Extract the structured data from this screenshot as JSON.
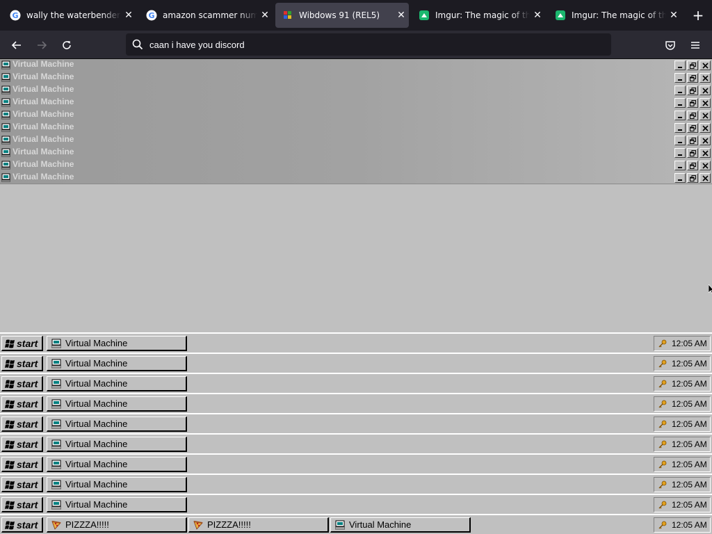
{
  "browser": {
    "tabs": [
      {
        "title": "wally the waterbender - Go",
        "favicon": "google-icon",
        "active": false
      },
      {
        "title": "amazon scammer numbers",
        "favicon": "google-icon",
        "active": false
      },
      {
        "title": "Wibdows 91 (REL5)",
        "favicon": "windows-flag-icon",
        "active": true
      },
      {
        "title": "Imgur: The magic of the Int",
        "favicon": "imgur-icon",
        "active": false
      },
      {
        "title": "Imgur: The magic of the Int",
        "favicon": "imgur-icon",
        "active": false
      }
    ],
    "new_tab": "+",
    "url_value": "caan i have you discord",
    "icons": [
      "back-icon",
      "forward-icon",
      "reload-icon",
      "search-icon",
      "pocket-icon",
      "menu-icon",
      "close-icon"
    ]
  },
  "vm_windows": [
    {
      "title": "Virtual Machine"
    },
    {
      "title": "Virtual Machine"
    },
    {
      "title": "Virtual Machine"
    },
    {
      "title": "Virtual Machine"
    },
    {
      "title": "Virtual Machine"
    },
    {
      "title": "Virtual Machine"
    },
    {
      "title": "Virtual Machine"
    },
    {
      "title": "Virtual Machine"
    },
    {
      "title": "Virtual Machine"
    },
    {
      "title": "Virtual Machine"
    }
  ],
  "taskbars": [
    {
      "start": "start",
      "clock": "12:05 AM",
      "tasks": [
        {
          "label": "Virtual Machine",
          "icon": "computer-icon"
        }
      ]
    },
    {
      "start": "start",
      "clock": "12:05 AM",
      "tasks": [
        {
          "label": "Virtual Machine",
          "icon": "computer-icon"
        }
      ]
    },
    {
      "start": "start",
      "clock": "12:05 AM",
      "tasks": [
        {
          "label": "Virtual Machine",
          "icon": "computer-icon"
        }
      ]
    },
    {
      "start": "start",
      "clock": "12:05 AM",
      "tasks": [
        {
          "label": "Virtual Machine",
          "icon": "computer-icon"
        }
      ]
    },
    {
      "start": "start",
      "clock": "12:05 AM",
      "tasks": [
        {
          "label": "Virtual Machine",
          "icon": "computer-icon"
        }
      ]
    },
    {
      "start": "start",
      "clock": "12:05 AM",
      "tasks": [
        {
          "label": "Virtual Machine",
          "icon": "computer-icon"
        }
      ]
    },
    {
      "start": "start",
      "clock": "12:05 AM",
      "tasks": [
        {
          "label": "Virtual Machine",
          "icon": "computer-icon"
        }
      ]
    },
    {
      "start": "start",
      "clock": "12:05 AM",
      "tasks": [
        {
          "label": "Virtual Machine",
          "icon": "computer-icon"
        }
      ]
    },
    {
      "start": "start",
      "clock": "12:05 AM",
      "tasks": [
        {
          "label": "Virtual Machine",
          "icon": "computer-icon"
        }
      ]
    },
    {
      "start": "start",
      "clock": "12:05 AM",
      "tasks": [
        {
          "label": "PIZZZA!!!!!",
          "icon": "pizza-icon"
        },
        {
          "label": "PIZZZA!!!!!",
          "icon": "pizza-icon"
        },
        {
          "label": "Virtual Machine",
          "icon": "computer-icon"
        }
      ]
    }
  ],
  "colors": {
    "browser_bg": "#1c1b22",
    "toolbar_bg": "#2b2a33",
    "win95_gray": "#c0c0c0",
    "inactive_title_text": "#d8d8d8"
  }
}
